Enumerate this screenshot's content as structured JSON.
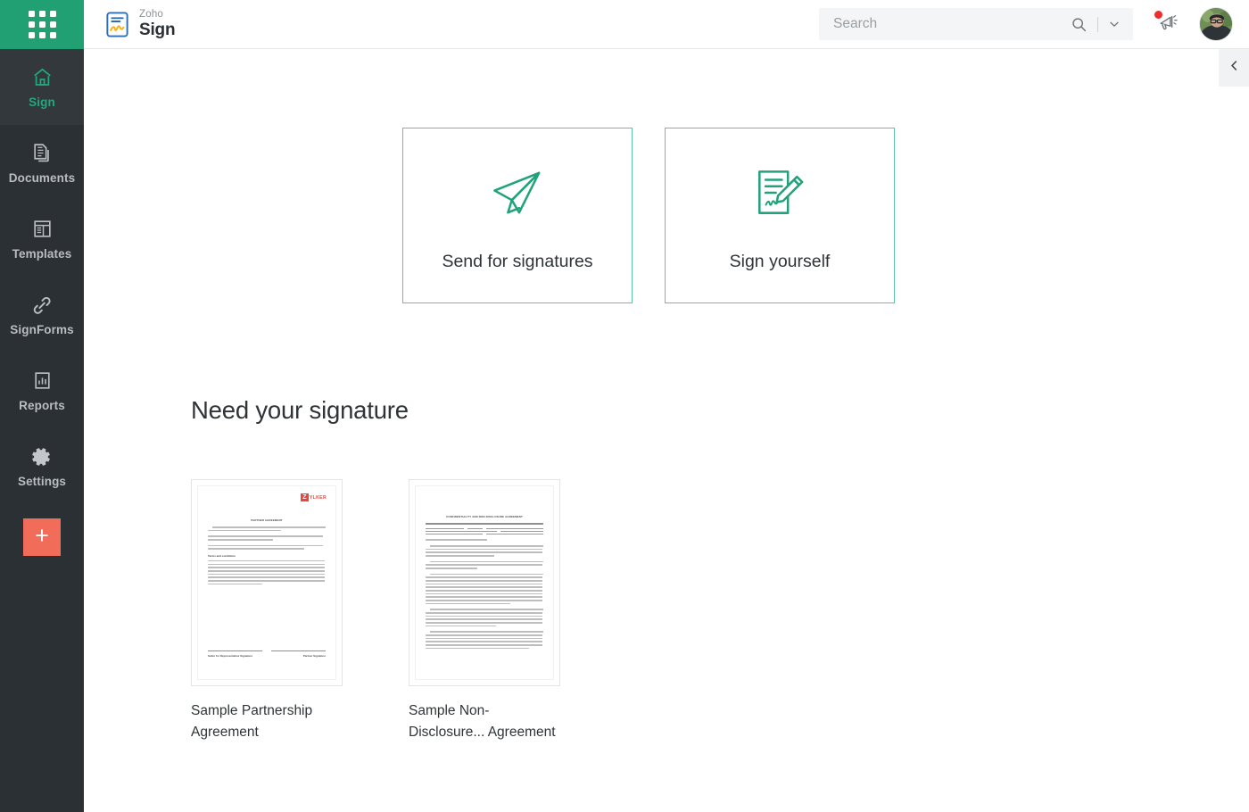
{
  "brand": {
    "app_launcher_icon": "app-grid-icon",
    "logo_top": "Zoho",
    "logo_bottom": "Sign",
    "accent_green": "#21a073",
    "card_border_green": "#5dc6a1",
    "sidebar_bg": "#2b3034",
    "add_button_color": "#f26c5a"
  },
  "sidebar": {
    "items": [
      {
        "label": "Sign",
        "icon": "home-icon",
        "active": true
      },
      {
        "label": "Documents",
        "icon": "documents-icon",
        "active": false
      },
      {
        "label": "Templates",
        "icon": "templates-icon",
        "active": false
      },
      {
        "label": "SignForms",
        "icon": "link-icon",
        "active": false
      },
      {
        "label": "Reports",
        "icon": "chart-icon",
        "active": false
      },
      {
        "label": "Settings",
        "icon": "gear-icon",
        "active": false
      }
    ],
    "add_button_label": "+"
  },
  "header": {
    "search": {
      "value": "",
      "placeholder": "Search",
      "search_icon": "search-icon",
      "caret_icon": "chevron-down-icon"
    },
    "notifications": {
      "icon": "megaphone-icon",
      "badge": true,
      "badge_color": "#ee2d2d"
    },
    "avatar_icon": "user-avatar"
  },
  "main": {
    "collapse_icon": "chevron-left-icon",
    "action_cards": [
      {
        "label": "Send for signatures",
        "icon": "paper-plane-icon"
      },
      {
        "label": "Sign yourself",
        "icon": "document-pencil-icon"
      }
    ],
    "section_title": "Need your signature",
    "documents": [
      {
        "name": "Sample Partnership Agreement",
        "thumb": {
          "logo_text": "YLKER",
          "logo_mark": "Z",
          "title": "PARTNER AGREEMENT",
          "subheading": "Terms and conditions",
          "signature_labels": [
            "Seller for Representative Signature",
            "Partner Signature"
          ]
        }
      },
      {
        "name": "Sample Non-Disclosure... Agreement",
        "thumb": {
          "title": "CONFIDENTIALITY AND NON-DISCLOSURE AGREEMENT",
          "subtitle": "THIS CONFIDENTIALITY AND NON-DISCLOSURE AGREEMENT (this \"Agreement\") made this",
          "subheading": "NOW, THEREFORE,"
        }
      }
    ]
  }
}
